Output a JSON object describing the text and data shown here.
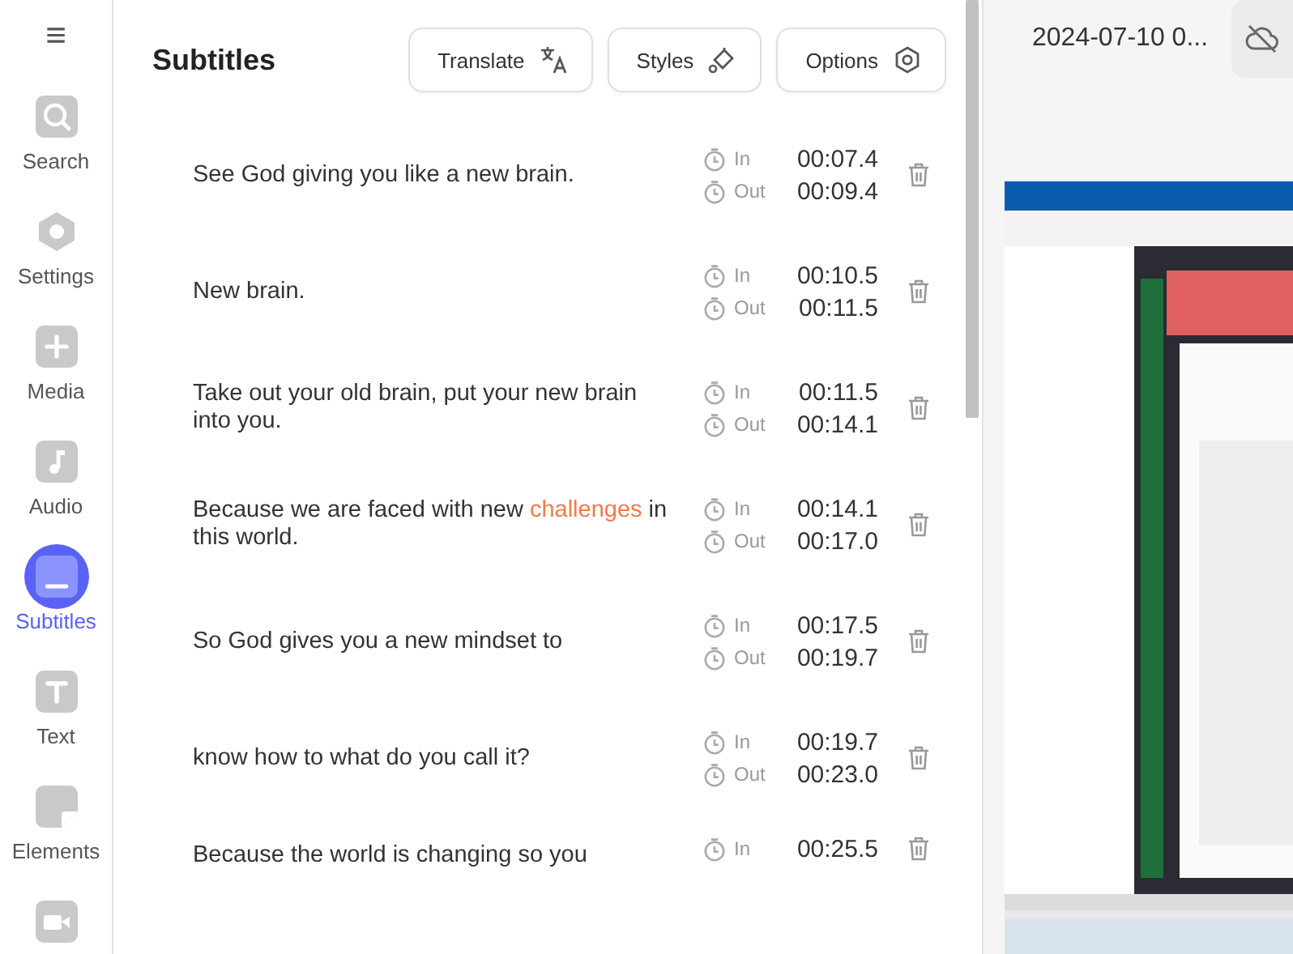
{
  "menu_button": "≡",
  "sidebar": {
    "items": [
      {
        "kind": "search",
        "label": "Search",
        "selected": false
      },
      {
        "kind": "settings",
        "label": "Settings",
        "selected": false
      },
      {
        "kind": "media",
        "label": "Media",
        "selected": false
      },
      {
        "kind": "audio",
        "label": "Audio",
        "selected": false
      },
      {
        "kind": "subtitles",
        "label": "Subtitles",
        "selected": true
      },
      {
        "kind": "text",
        "label": "Text",
        "selected": false
      },
      {
        "kind": "elements",
        "label": "Elements",
        "selected": false
      },
      {
        "kind": "video",
        "selected": false
      }
    ]
  },
  "header": {
    "title": "Subtitles",
    "buttons": [
      {
        "label": "Translate",
        "kind": "translate"
      },
      {
        "label": "Styles",
        "kind": "paint"
      },
      {
        "label": "Options",
        "kind": "gear"
      }
    ]
  },
  "subtitles": [
    {
      "segments": [
        {
          "text": "See God giving you like a new brain.",
          "highlighted": false
        }
      ],
      "in_label": "In",
      "in": "00:07.4",
      "out_label": "Out",
      "out": "00:09.4"
    },
    {
      "segments": [
        {
          "text": "New brain.",
          "highlighted": false
        }
      ],
      "in_label": "In",
      "in": "00:10.5",
      "out_label": "Out",
      "out": "00:11.5"
    },
    {
      "segments": [
        {
          "text": "Take out your old brain, put your new brain into you.",
          "highlighted": false
        }
      ],
      "in_label": "In",
      "in": "00:11.5",
      "out_label": "Out",
      "out": "00:14.1"
    },
    {
      "segments": [
        {
          "text": "Because we are faced with new ",
          "highlighted": false
        },
        {
          "text": "challenges",
          "highlighted": true
        },
        {
          "text": " in this world.",
          "highlighted": false
        }
      ],
      "in_label": "In",
      "in": "00:14.1",
      "out_label": "Out",
      "out": "00:17.0"
    },
    {
      "segments": [
        {
          "text": "So God gives you a new mindset to",
          "highlighted": false
        }
      ],
      "in_label": "In",
      "in": "00:17.5",
      "out_label": "Out",
      "out": "00:19.7"
    },
    {
      "segments": [
        {
          "text": "know how to what do you call it?",
          "highlighted": false
        }
      ],
      "in_label": "In",
      "in": "00:19.7",
      "out_label": "Out",
      "out": "00:23.0"
    },
    {
      "segments": [
        {
          "text": "Because the world is changing so you",
          "highlighted": false
        }
      ],
      "in_label": "In",
      "in": "00:25.5"
    }
  ],
  "preview": {
    "title": "2024-07-10 0..."
  }
}
